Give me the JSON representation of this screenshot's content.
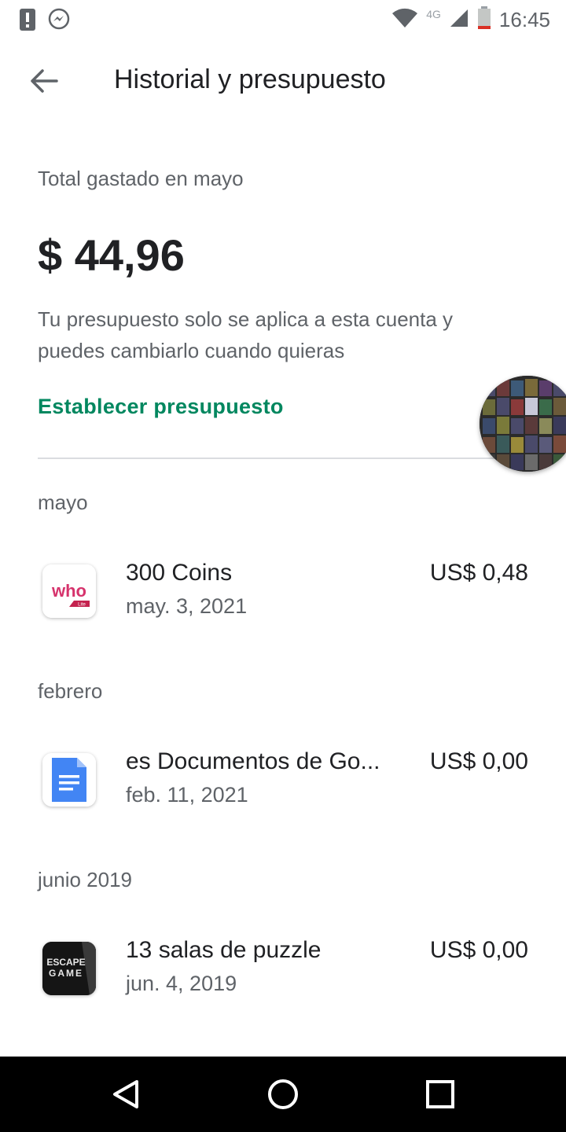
{
  "status_bar": {
    "time": "16:45",
    "network": "4G",
    "icons": [
      "alert-icon",
      "messenger-icon",
      "wifi-icon",
      "signal-icon",
      "battery-icon"
    ]
  },
  "app_bar": {
    "title": "Historial y presupuesto",
    "back_icon": "back-arrow-icon"
  },
  "summary": {
    "label": "Total gastado en mayo",
    "amount": "$ 44,96",
    "note": "Tu presupuesto solo se aplica a esta cuenta y puedes cambiarlo cuando quieras",
    "set_budget": "Establecer presupuesto"
  },
  "sections": [
    {
      "month": "mayo",
      "items": [
        {
          "title": "300 Coins",
          "date": "may. 3, 2021",
          "price": "US$ 0,48",
          "icon": "who-app-icon"
        }
      ]
    },
    {
      "month": "febrero",
      "items": [
        {
          "title": "es Documentos de Go...",
          "date": "feb. 11, 2021",
          "price": "US$ 0,00",
          "icon": "google-docs-icon"
        }
      ]
    },
    {
      "month": "junio 2019",
      "items": [
        {
          "title": "13 salas de puzzle",
          "date": "jun. 4, 2019",
          "price": "US$ 0,00",
          "icon": "escape-game-icon"
        }
      ]
    }
  ],
  "icon_text": {
    "who": "who",
    "lite": "Lite",
    "escape": "ESCAPE",
    "game": "GAME"
  },
  "colors": {
    "accent": "#01875f",
    "text_primary": "#202124",
    "text_secondary": "#5f6368"
  }
}
